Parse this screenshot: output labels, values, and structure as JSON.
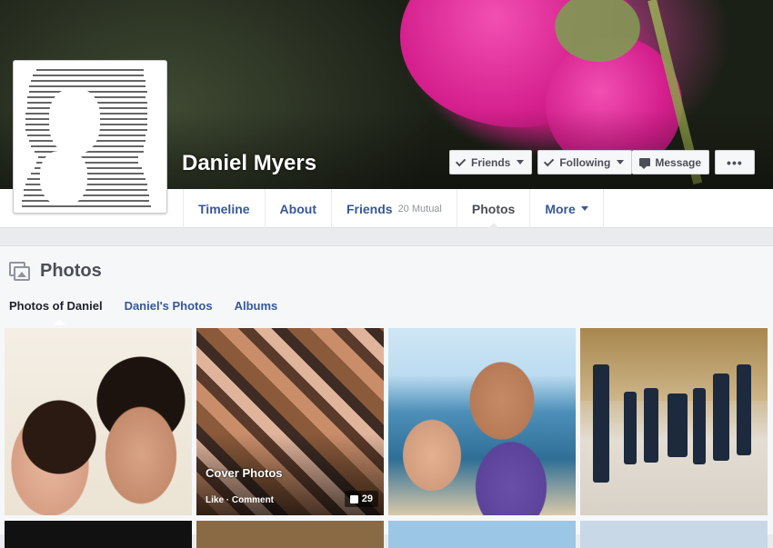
{
  "profile": {
    "name": "Daniel Myers"
  },
  "actions": {
    "friends_label": "Friends",
    "following_label": "Following",
    "message_label": "Message",
    "more_label": "•••"
  },
  "nav": {
    "timeline": "Timeline",
    "about": "About",
    "friends": "Friends",
    "friends_sub": "20 Mutual",
    "photos": "Photos",
    "more": "More"
  },
  "photos": {
    "title": "Photos",
    "tabs": [
      "Photos of Daniel",
      "Daniel's Photos",
      "Albums"
    ]
  },
  "album": {
    "title": "Cover Photos",
    "actions": "Like · Comment",
    "likes": "29"
  },
  "colors": {
    "link": "#365899",
    "text": "#4b4f56",
    "background": "#e9ebee"
  }
}
